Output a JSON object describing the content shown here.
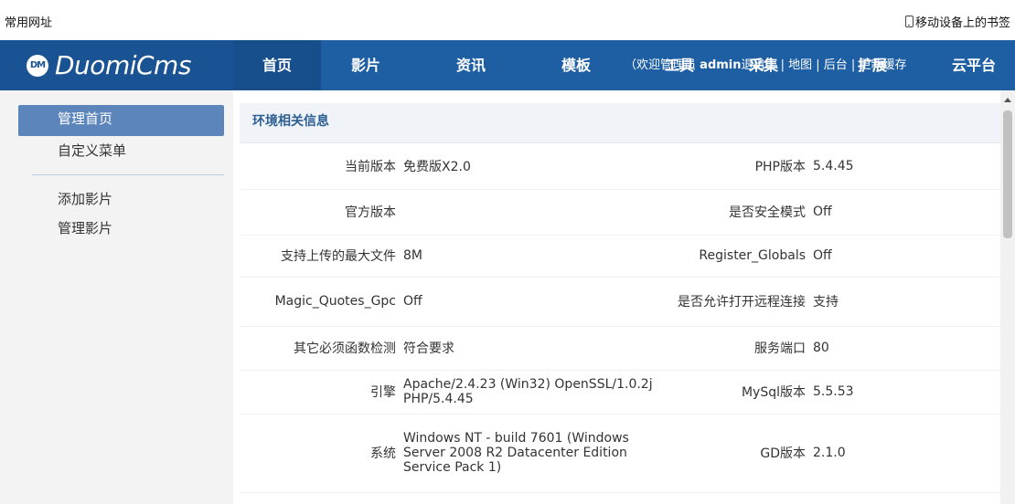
{
  "bookmarks": {
    "left_label": "常用网址",
    "right_label": "移动设备上的书签"
  },
  "logo": {
    "badge": "DM",
    "text": "DuomiCms"
  },
  "nav": {
    "items": [
      {
        "label": "首页"
      },
      {
        "label": "影片"
      },
      {
        "label": "资讯"
      },
      {
        "label": "模板"
      }
    ],
    "userbar": {
      "prefix": "（欢迎",
      "role": "管理员",
      "user": "admin",
      "suffix": "退出 ）| 地图 | 后台 | 更新缓存"
    },
    "overlap_items": [
      "工具",
      "采集",
      "扩展",
      "云平台"
    ]
  },
  "sidebar": {
    "items": [
      {
        "label": "管理首页"
      },
      {
        "label": "自定义菜单"
      },
      {
        "label": "添加影片"
      },
      {
        "label": "管理影片"
      }
    ]
  },
  "panel": {
    "title": "环境相关信息",
    "rows": [
      {
        "k1": "当前版本",
        "v1": "免费版X2.0",
        "k2": "PHP版本",
        "v2": "5.4.45"
      },
      {
        "k1": "官方版本",
        "v1": "",
        "k2": "是否安全模式",
        "v2": "Off"
      },
      {
        "k1": "支持上传的最大文件",
        "v1": "8M",
        "k2": "Register_Globals",
        "v2": "Off"
      },
      {
        "k1": "Magic_Quotes_Gpc",
        "v1": "Off",
        "k2": "是否允许打开远程连接",
        "v2": "支持"
      },
      {
        "k1": "其它必须函数检测",
        "v1": "符合要求",
        "k2": "服务端口",
        "v2": "80"
      },
      {
        "k1": "引擎",
        "v1": "Apache/2.4.23 (Win32) OpenSSL/1.0.2j PHP/5.4.45",
        "k2": "MySql版本",
        "v2": "5.5.53"
      },
      {
        "k1": "系统",
        "v1": "Windows NT - build 7601 (Windows Server 2008 R2 Datacenter Edition Service Pack 1)",
        "k2": "GD版本",
        "v2": "2.1.0"
      }
    ]
  },
  "colors": {
    "nav_bg": "#1e5fa3",
    "logo_bg": "#1a5393",
    "sidebar_active": "#5b85bb",
    "panel_title": "#2c5e92"
  }
}
